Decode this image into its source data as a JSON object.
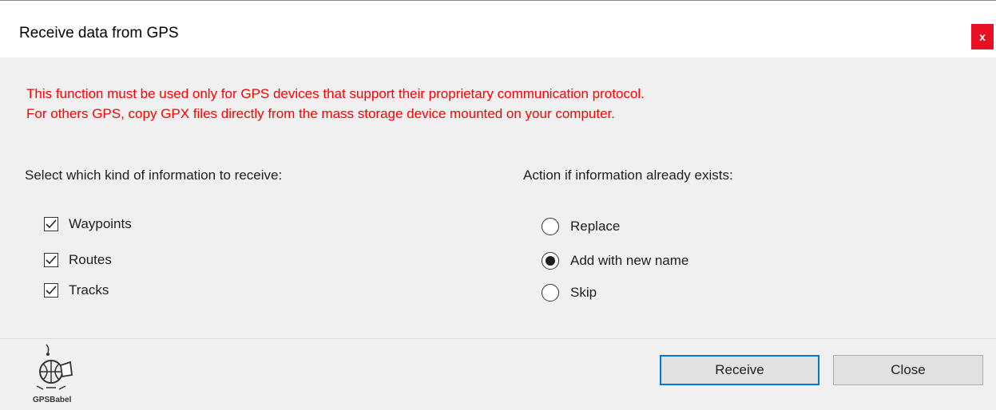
{
  "window": {
    "title": "Receive data from GPS",
    "close_glyph": "x"
  },
  "warning": {
    "line1": "This function must be used only for GPS devices that support their proprietary communication protocol.",
    "line2": "For others GPS, copy GPX files directly from the mass storage device mounted on your computer.",
    "color": "#ff0000"
  },
  "info_types": {
    "label": "Select which kind of information to receive:",
    "options": [
      {
        "label": "Waypoints",
        "checked": true
      },
      {
        "label": "Routes",
        "checked": true
      },
      {
        "label": "Tracks",
        "checked": true
      }
    ]
  },
  "action": {
    "label": "Action if information already exists:",
    "options": [
      {
        "label": "Replace",
        "selected": false
      },
      {
        "label": "Add with new name",
        "selected": true
      },
      {
        "label": "Skip",
        "selected": false
      }
    ]
  },
  "buttons": {
    "receive": "Receive",
    "close": "Close"
  },
  "logo": {
    "icon": "gpsbabel-logo-icon",
    "text": "GPSBabel"
  },
  "colors": {
    "accent": "#0078d7",
    "close_button": "#e81123"
  }
}
